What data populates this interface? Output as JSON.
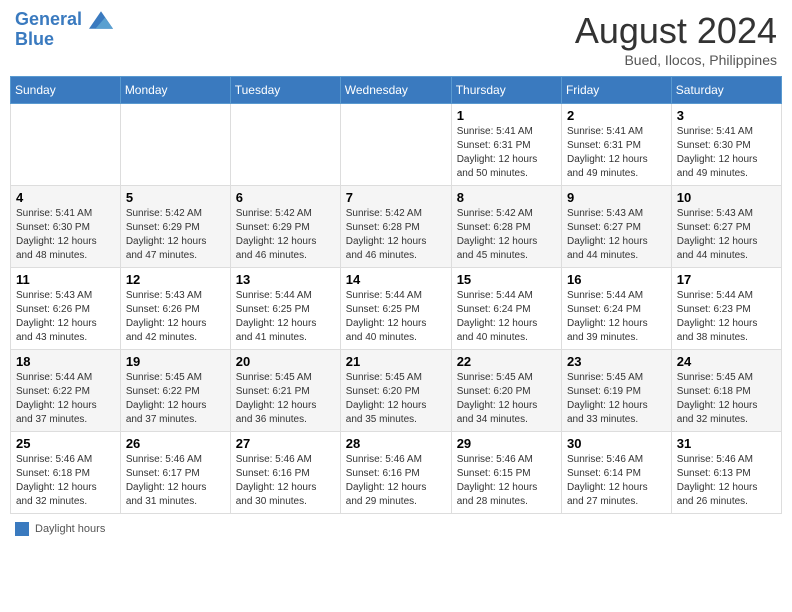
{
  "header": {
    "logo_line1": "General",
    "logo_line2": "Blue",
    "month_title": "August 2024",
    "location": "Bued, Ilocos, Philippines"
  },
  "footer": {
    "legend_label": "Daylight hours"
  },
  "days_of_week": [
    "Sunday",
    "Monday",
    "Tuesday",
    "Wednesday",
    "Thursday",
    "Friday",
    "Saturday"
  ],
  "weeks": [
    [
      {
        "num": "",
        "info": ""
      },
      {
        "num": "",
        "info": ""
      },
      {
        "num": "",
        "info": ""
      },
      {
        "num": "",
        "info": ""
      },
      {
        "num": "1",
        "info": "Sunrise: 5:41 AM\nSunset: 6:31 PM\nDaylight: 12 hours\nand 50 minutes."
      },
      {
        "num": "2",
        "info": "Sunrise: 5:41 AM\nSunset: 6:31 PM\nDaylight: 12 hours\nand 49 minutes."
      },
      {
        "num": "3",
        "info": "Sunrise: 5:41 AM\nSunset: 6:30 PM\nDaylight: 12 hours\nand 49 minutes."
      }
    ],
    [
      {
        "num": "4",
        "info": "Sunrise: 5:41 AM\nSunset: 6:30 PM\nDaylight: 12 hours\nand 48 minutes."
      },
      {
        "num": "5",
        "info": "Sunrise: 5:42 AM\nSunset: 6:29 PM\nDaylight: 12 hours\nand 47 minutes."
      },
      {
        "num": "6",
        "info": "Sunrise: 5:42 AM\nSunset: 6:29 PM\nDaylight: 12 hours\nand 46 minutes."
      },
      {
        "num": "7",
        "info": "Sunrise: 5:42 AM\nSunset: 6:28 PM\nDaylight: 12 hours\nand 46 minutes."
      },
      {
        "num": "8",
        "info": "Sunrise: 5:42 AM\nSunset: 6:28 PM\nDaylight: 12 hours\nand 45 minutes."
      },
      {
        "num": "9",
        "info": "Sunrise: 5:43 AM\nSunset: 6:27 PM\nDaylight: 12 hours\nand 44 minutes."
      },
      {
        "num": "10",
        "info": "Sunrise: 5:43 AM\nSunset: 6:27 PM\nDaylight: 12 hours\nand 44 minutes."
      }
    ],
    [
      {
        "num": "11",
        "info": "Sunrise: 5:43 AM\nSunset: 6:26 PM\nDaylight: 12 hours\nand 43 minutes."
      },
      {
        "num": "12",
        "info": "Sunrise: 5:43 AM\nSunset: 6:26 PM\nDaylight: 12 hours\nand 42 minutes."
      },
      {
        "num": "13",
        "info": "Sunrise: 5:44 AM\nSunset: 6:25 PM\nDaylight: 12 hours\nand 41 minutes."
      },
      {
        "num": "14",
        "info": "Sunrise: 5:44 AM\nSunset: 6:25 PM\nDaylight: 12 hours\nand 40 minutes."
      },
      {
        "num": "15",
        "info": "Sunrise: 5:44 AM\nSunset: 6:24 PM\nDaylight: 12 hours\nand 40 minutes."
      },
      {
        "num": "16",
        "info": "Sunrise: 5:44 AM\nSunset: 6:24 PM\nDaylight: 12 hours\nand 39 minutes."
      },
      {
        "num": "17",
        "info": "Sunrise: 5:44 AM\nSunset: 6:23 PM\nDaylight: 12 hours\nand 38 minutes."
      }
    ],
    [
      {
        "num": "18",
        "info": "Sunrise: 5:44 AM\nSunset: 6:22 PM\nDaylight: 12 hours\nand 37 minutes."
      },
      {
        "num": "19",
        "info": "Sunrise: 5:45 AM\nSunset: 6:22 PM\nDaylight: 12 hours\nand 37 minutes."
      },
      {
        "num": "20",
        "info": "Sunrise: 5:45 AM\nSunset: 6:21 PM\nDaylight: 12 hours\nand 36 minutes."
      },
      {
        "num": "21",
        "info": "Sunrise: 5:45 AM\nSunset: 6:20 PM\nDaylight: 12 hours\nand 35 minutes."
      },
      {
        "num": "22",
        "info": "Sunrise: 5:45 AM\nSunset: 6:20 PM\nDaylight: 12 hours\nand 34 minutes."
      },
      {
        "num": "23",
        "info": "Sunrise: 5:45 AM\nSunset: 6:19 PM\nDaylight: 12 hours\nand 33 minutes."
      },
      {
        "num": "24",
        "info": "Sunrise: 5:45 AM\nSunset: 6:18 PM\nDaylight: 12 hours\nand 32 minutes."
      }
    ],
    [
      {
        "num": "25",
        "info": "Sunrise: 5:46 AM\nSunset: 6:18 PM\nDaylight: 12 hours\nand 32 minutes."
      },
      {
        "num": "26",
        "info": "Sunrise: 5:46 AM\nSunset: 6:17 PM\nDaylight: 12 hours\nand 31 minutes."
      },
      {
        "num": "27",
        "info": "Sunrise: 5:46 AM\nSunset: 6:16 PM\nDaylight: 12 hours\nand 30 minutes."
      },
      {
        "num": "28",
        "info": "Sunrise: 5:46 AM\nSunset: 6:16 PM\nDaylight: 12 hours\nand 29 minutes."
      },
      {
        "num": "29",
        "info": "Sunrise: 5:46 AM\nSunset: 6:15 PM\nDaylight: 12 hours\nand 28 minutes."
      },
      {
        "num": "30",
        "info": "Sunrise: 5:46 AM\nSunset: 6:14 PM\nDaylight: 12 hours\nand 27 minutes."
      },
      {
        "num": "31",
        "info": "Sunrise: 5:46 AM\nSunset: 6:13 PM\nDaylight: 12 hours\nand 26 minutes."
      }
    ]
  ]
}
